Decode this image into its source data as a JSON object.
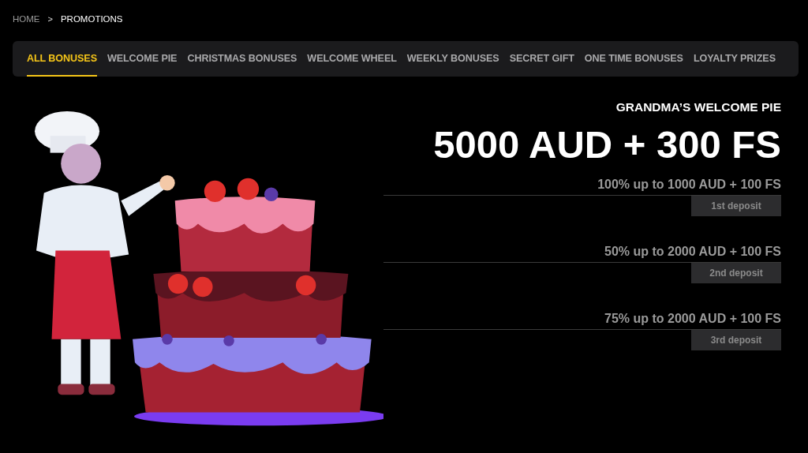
{
  "breadcrumb": [
    {
      "label": "HOME",
      "current": false
    },
    {
      "label": "PROMOTIONS",
      "current": true
    }
  ],
  "breadcrumb_separator": ">",
  "tabs": [
    {
      "label": "ALL BONUSES",
      "selected": true
    },
    {
      "label": "WELCOME PIE",
      "selected": false
    },
    {
      "label": "CHRISTMAS BONUSES",
      "selected": false
    },
    {
      "label": "WELCOME WHEEL",
      "selected": false
    },
    {
      "label": "WEEKLY BONUSES",
      "selected": false
    },
    {
      "label": "SECRET GIFT",
      "selected": false
    },
    {
      "label": "ONE TIME BONUSES",
      "selected": false
    },
    {
      "label": "LOYALTY PRIZES",
      "selected": false
    }
  ],
  "promo": {
    "subtitle": "GRANDMA’S WELCOME PIE",
    "headline": "5000 AUD + 300 FS",
    "deposits": [
      {
        "offer": "100% up to 1000 AUD + 100 FS",
        "label": "1st deposit"
      },
      {
        "offer": "50% up to 2000 AUD + 100 FS",
        "label": "2nd deposit"
      },
      {
        "offer": "75% up to 2000 AUD + 100 FS",
        "label": "3rd deposit"
      }
    ]
  }
}
